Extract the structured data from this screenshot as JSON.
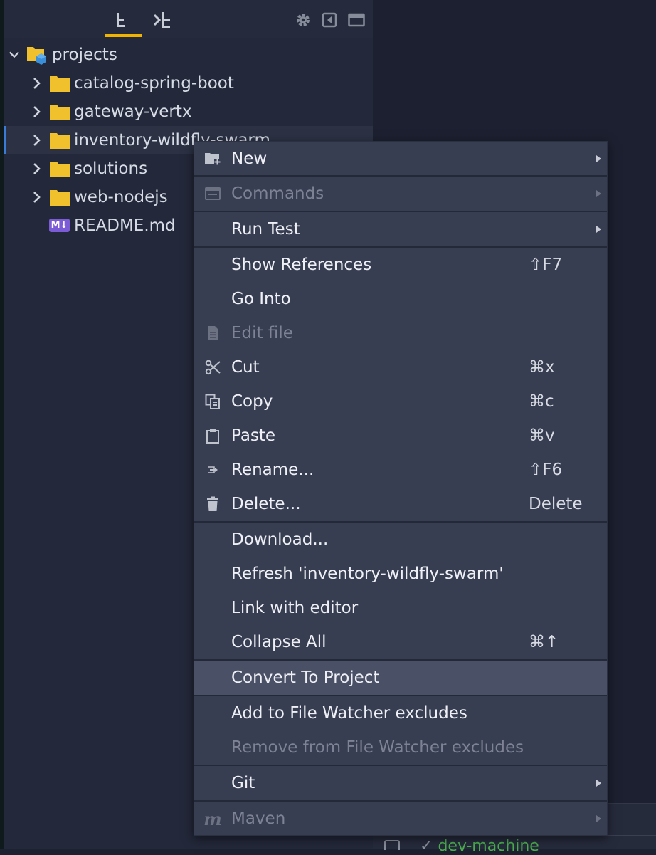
{
  "explorer": {
    "toolbar": {
      "icons": [
        "project-tree-icon",
        "structure-icon",
        "gear-icon",
        "collapse-left-icon",
        "maximize-icon"
      ]
    },
    "tree": [
      {
        "label": "projects",
        "type": "root",
        "expanded": true
      },
      {
        "label": "catalog-spring-boot",
        "type": "folder"
      },
      {
        "label": "gateway-vertx",
        "type": "folder"
      },
      {
        "label": "inventory-wildfly-swarm",
        "type": "folder",
        "selected": true
      },
      {
        "label": "solutions",
        "type": "folder"
      },
      {
        "label": "web-nodejs",
        "type": "folder"
      },
      {
        "label": "README.md",
        "type": "markdown",
        "badge": "M↓"
      }
    ]
  },
  "bottom": {
    "text": "dev-machine"
  },
  "colors": {
    "folder": "#f0c02d",
    "accent_underline": "#f0b400",
    "markdown_badge": "#7b5cd6",
    "selection_marker": "#3a7bd5",
    "status_green": "#4caf50"
  },
  "context_menu": {
    "items": [
      {
        "label": "New",
        "icon": "new-folder-icon",
        "submenu": true
      },
      {
        "label": "Commands",
        "icon": "terminal-icon",
        "submenu": true,
        "disabled": true
      },
      {
        "label": "Run Test",
        "submenu": true
      },
      {
        "label": "Show References",
        "shortcut": "⇧F7"
      },
      {
        "label": "Go Into"
      },
      {
        "label": "Edit file",
        "icon": "file-icon",
        "disabled": true
      },
      {
        "label": "Cut",
        "icon": "scissors-icon",
        "shortcut": "⌘x"
      },
      {
        "label": "Copy",
        "icon": "copy-icon",
        "shortcut": "⌘c"
      },
      {
        "label": "Paste",
        "icon": "clipboard-icon",
        "shortcut": "⌘v"
      },
      {
        "label": "Rename...",
        "icon": "rename-icon",
        "shortcut": "⇧F6"
      },
      {
        "label": "Delete...",
        "icon": "trash-icon",
        "shortcut": "Delete"
      },
      {
        "label": "Download..."
      },
      {
        "label": "Refresh 'inventory-wildfly-swarm'"
      },
      {
        "label": "Link with editor"
      },
      {
        "label": "Collapse All",
        "shortcut": "⌘↑"
      },
      {
        "label": "Convert To Project",
        "highlighted": true
      },
      {
        "label": "Add to File Watcher excludes"
      },
      {
        "label": "Remove from File Watcher excludes",
        "disabled": true
      },
      {
        "label": "Git",
        "submenu": true
      },
      {
        "label": "Maven",
        "icon": "maven-icon",
        "icon_glyph": "m",
        "submenu": true,
        "disabled": true
      }
    ]
  }
}
